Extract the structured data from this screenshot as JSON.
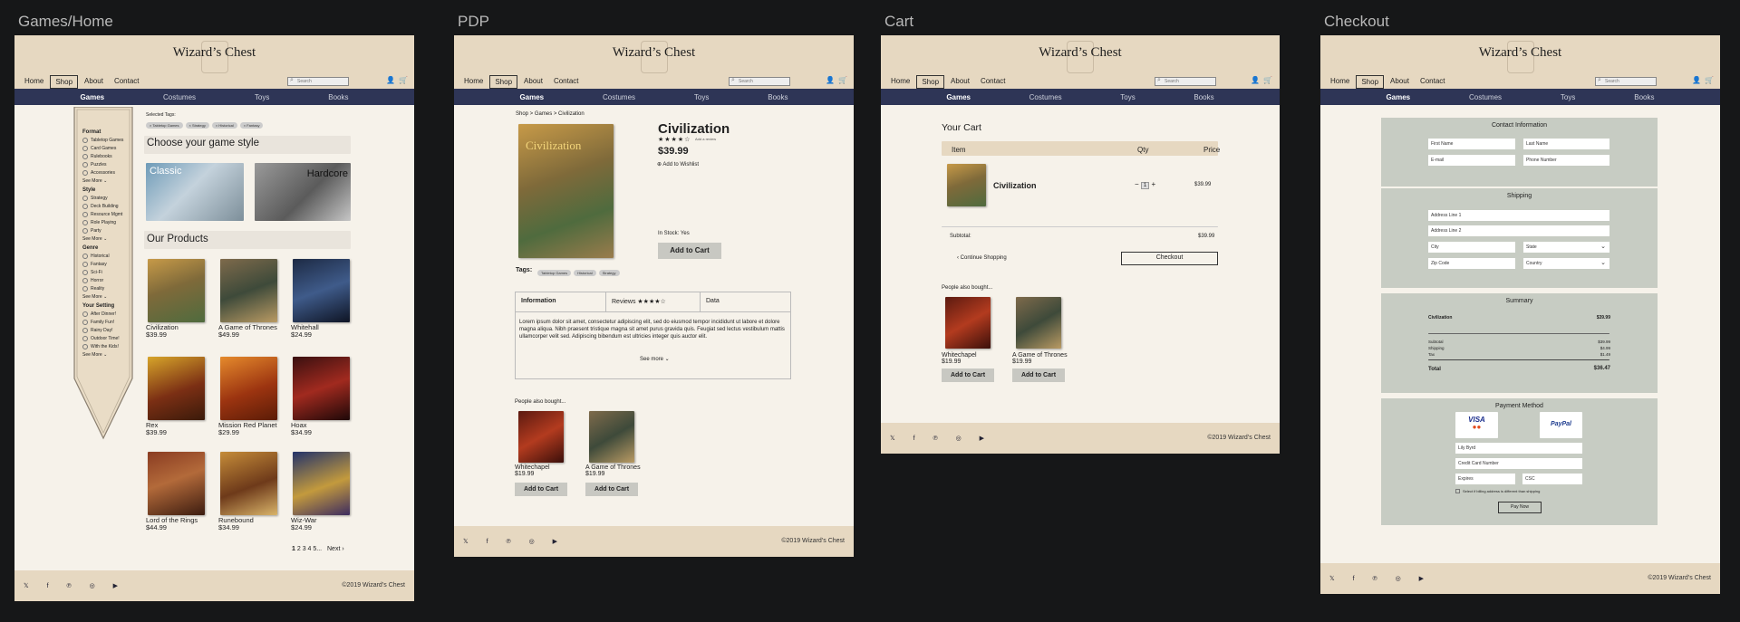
{
  "frames": [
    "Games/Home",
    "PDP",
    "Cart",
    "Checkout"
  ],
  "site": {
    "logo": "Wizard’s Chest",
    "nav": [
      "Home",
      "Shop",
      "About",
      "Contact"
    ],
    "search_placeholder": "Search",
    "subnav": [
      "Games",
      "Costumes",
      "Toys",
      "Books"
    ],
    "copyright": "©2019 Wizard’s Chest",
    "social": [
      "twitter-icon",
      "facebook-icon",
      "pinterest-icon",
      "instagram-icon",
      "youtube-icon"
    ]
  },
  "home": {
    "selected_tags_label": "Selected Tags:",
    "selected_tags": [
      "× Tabletop Games",
      "× Strategy",
      "× Historical",
      "× Fantasy"
    ],
    "filters": [
      {
        "title": "Format",
        "items": [
          "Tabletop Games",
          "Card Games",
          "Rulebooks",
          "Puzzles",
          "Accessories"
        ]
      },
      {
        "title": "Style",
        "items": [
          "Strategy",
          "Deck Building",
          "Resource Mgmt",
          "Role Playing",
          "Party"
        ]
      },
      {
        "title": "Genre",
        "items": [
          "Historical",
          "Fantasy",
          "Sci-Fi",
          "Horror",
          "Reality"
        ]
      },
      {
        "title": "Your Setting",
        "items": [
          "After Dinner!",
          "Family Fun!",
          "Rainy Day!",
          "Outdoor Time!",
          "With the Kids!"
        ]
      }
    ],
    "see_more": "See More ⌄",
    "style_heading": "Choose your game style",
    "styles": [
      "Classic",
      "Hardcore"
    ],
    "products_heading": "Our Products",
    "products": [
      {
        "name": "Civilization",
        "price": "$39.99"
      },
      {
        "name": "A Game of Thrones",
        "price": "$49.99"
      },
      {
        "name": "Whitehall",
        "price": "$24.99"
      },
      {
        "name": "Rex",
        "price": "$39.99"
      },
      {
        "name": "Mission Red Planet",
        "price": "$29.99"
      },
      {
        "name": "Hoax",
        "price": "$34.99"
      },
      {
        "name": "Lord of the Rings",
        "price": "$44.99"
      },
      {
        "name": "Runebound",
        "price": "$34.99"
      },
      {
        "name": "Wiz-War",
        "price": "$24.99"
      }
    ],
    "pagination_current": "1",
    "pagination_rest": "2 3 4 5...",
    "next": "Next ›"
  },
  "pdp": {
    "breadcrumb": "Shop > Games > Civilization",
    "title": "Civilization",
    "stars": "★★★★☆",
    "review_link": "Add a review",
    "price": "$39.99",
    "wishlist": "Add to Wishlist",
    "stock": "In Stock: Yes",
    "add_to_cart": "Add to Cart",
    "tags_label": "Tags:",
    "tags": [
      "Tabletop Games",
      "Historical",
      "Strategy"
    ],
    "tabs": [
      "Information",
      "Reviews",
      "Data"
    ],
    "tab_stars": "★★★★☆",
    "description": "Lorem ipsum dolor sit amet, consectetur adipiscing elit, sed do eiusmod tempor incididunt ut labore et dolore magna aliqua. Nibh praesent tristique magna sit amet purus gravida quis. Feugiat sed lectus vestibulum mattis ullamcorper velit sed. Adipiscing bibendum est ultricies integer quis auctor elit.",
    "see_more": "See more ⌄",
    "also_bought": "People also bought...",
    "related": [
      {
        "name": "Whitechapel",
        "price": "$19.99"
      },
      {
        "name": "A Game of Thrones",
        "price": "$19.99"
      }
    ]
  },
  "cart": {
    "title": "Your Cart",
    "headers": [
      "Item",
      "Qty",
      "Price"
    ],
    "item": {
      "name": "Civilization",
      "qty": "1",
      "price": "$39.99"
    },
    "subtotal_label": "Subtotal:",
    "subtotal": "$39.99",
    "continue": "‹  Continue Shopping",
    "checkout": "Checkout",
    "also_bought": "People also bought...",
    "related": [
      {
        "name": "Whitechapel",
        "price": "$19.99"
      },
      {
        "name": "A Game of Thrones",
        "price": "$19.99"
      }
    ],
    "add_to_cart": "Add to Cart"
  },
  "checkout": {
    "contact_title": "Contact Information",
    "first": "First Name",
    "last": "Last Name",
    "email": "E-mail",
    "phone": "Phone Number",
    "shipping_title": "Shipping",
    "addr1": "Address Line 1",
    "addr2": "Address Line 2",
    "city": "City",
    "state": "State",
    "zip": "Zip Code",
    "country": "Country",
    "summary_title": "Summary",
    "line_item": "Civilization",
    "line_price": "$39.99",
    "subtotal_label": "Subtotal",
    "subtotal": "$39.99",
    "shipping_label": "Shipping",
    "shipping": "$4.99",
    "tax_label": "Tax",
    "tax": "$1.49",
    "total_label": "Total",
    "total": "$36.47",
    "payment_title": "Payment Method",
    "visa": "VISA",
    "paypal": "PayPal",
    "name_field": "Lily Byrd",
    "card": "Credit Card Number",
    "expires": "Expires",
    "csc": "CSC",
    "billing_note": "Select if billing address is different than shipping",
    "pay": "Pay Now"
  }
}
